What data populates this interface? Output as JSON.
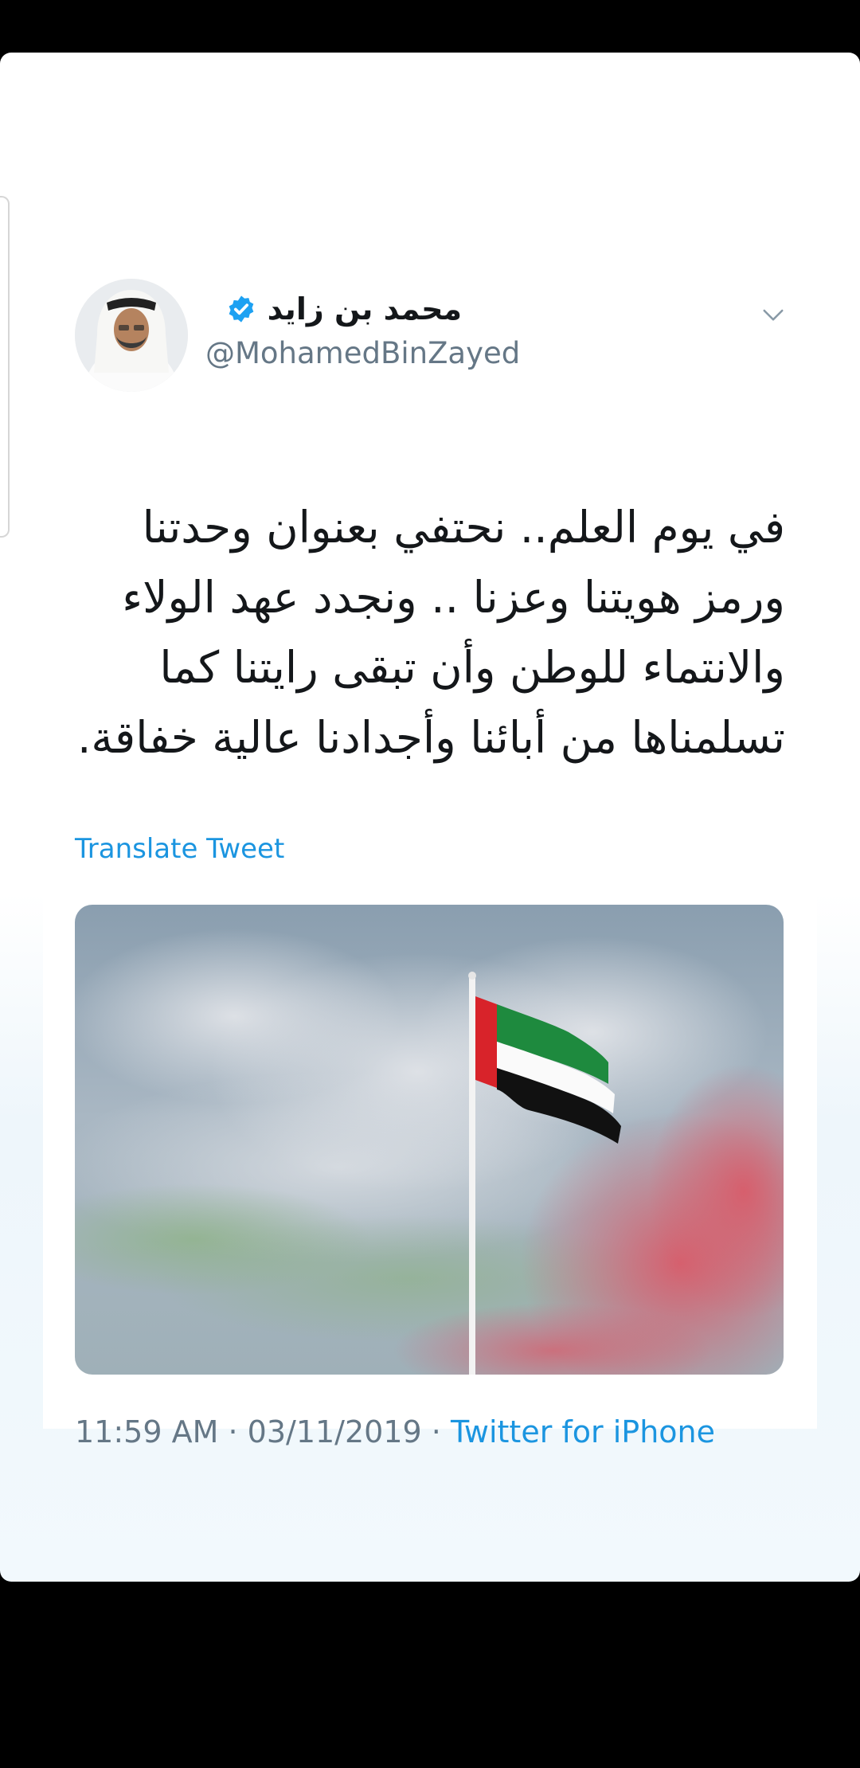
{
  "tweet": {
    "display_name": "محمد بن زايد",
    "handle": "@MohamedBinZayed",
    "verified": true,
    "text": "في يوم العلم.. نحتفي بعنوان وحدتنا ورمز هويتنا وعزنا .. ونجدد عهد الولاء والانتماء للوطن وأن تبقى رايتنا كما تسلمناها من أبائنا وأجدادنا عالية خفاقة.",
    "translate_label": "Translate Tweet",
    "time": "11:59 AM",
    "separator": "·",
    "date": "03/11/2019",
    "source": "Twitter for iPhone"
  },
  "icons": {
    "verified": "verified-badge-icon",
    "chevron": "chevron-down-icon"
  },
  "colors": {
    "link": "#1b95e0",
    "verified": "#1da1f2",
    "secondary_text": "#657786",
    "primary_text": "#14171a",
    "flag_red": "#d8232a",
    "flag_green": "#1e8a3e",
    "flag_black": "#111111",
    "flag_white": "#ffffff"
  }
}
